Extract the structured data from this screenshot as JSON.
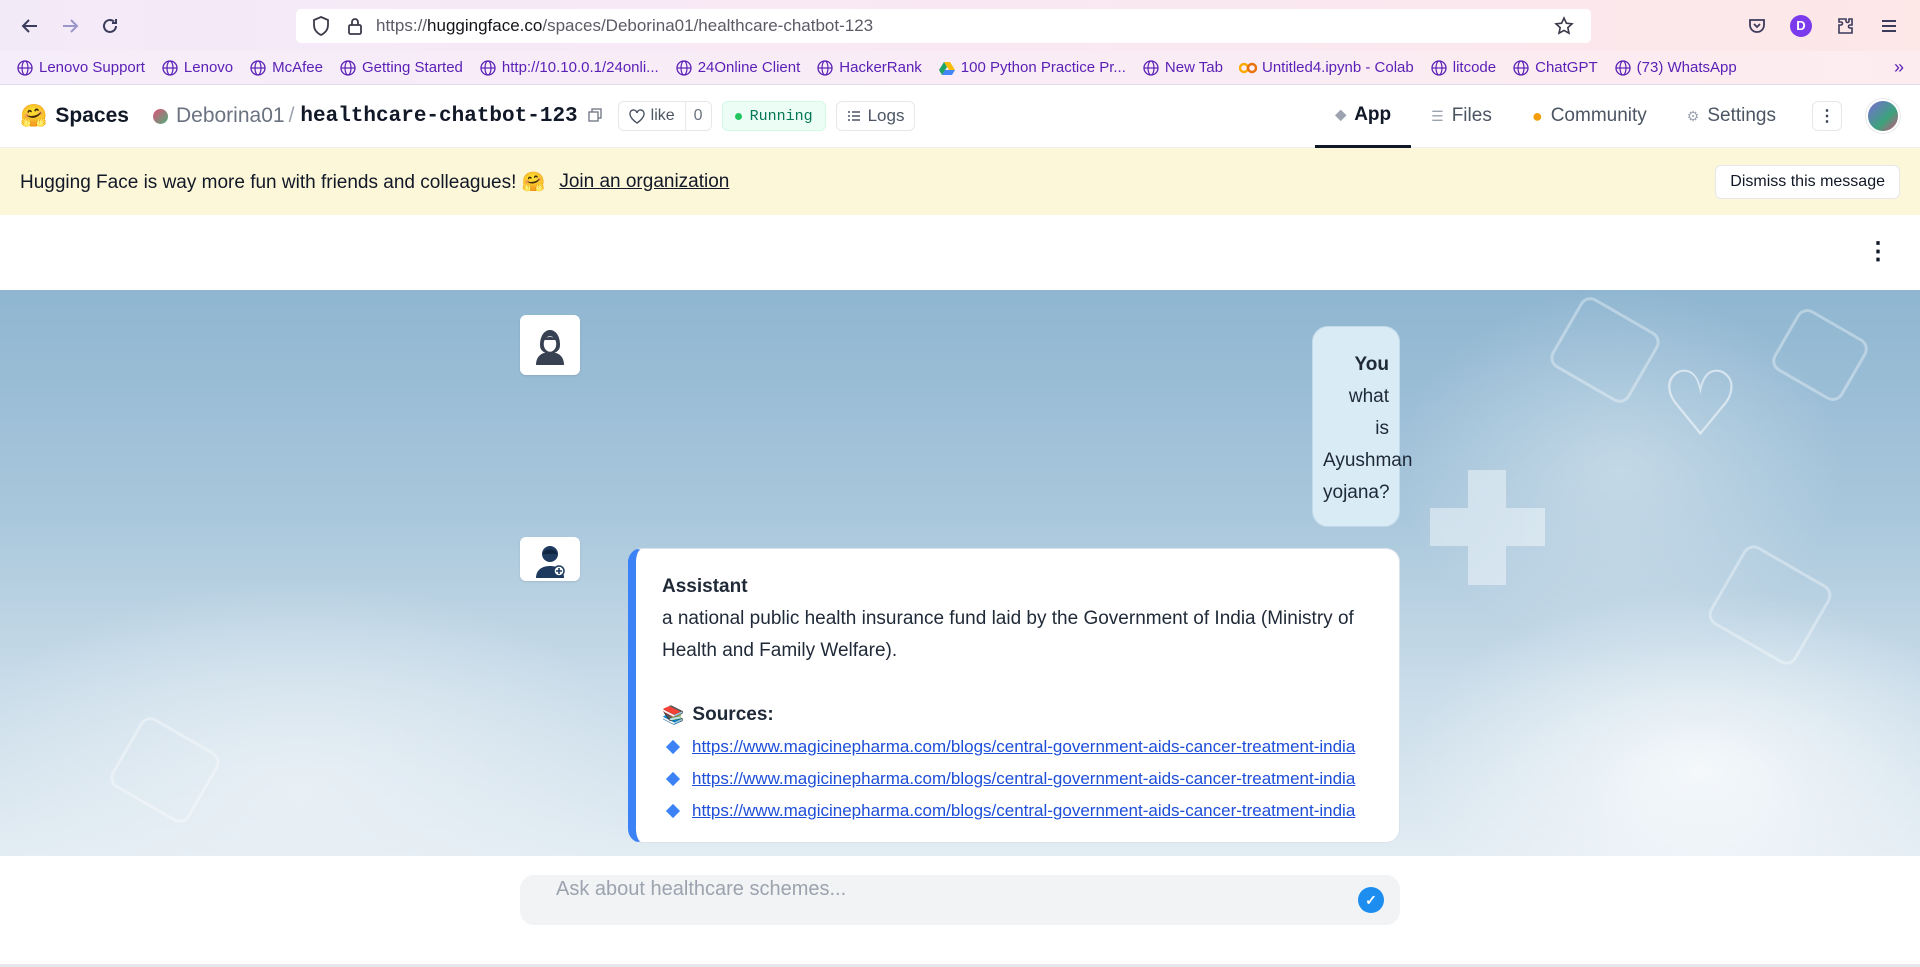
{
  "browser": {
    "url_prefix": "https://",
    "url_host": "huggingface.co",
    "url_path": "/spaces/Deborina01/healthcare-chatbot-123",
    "account_initial": "D"
  },
  "bookmarks": [
    {
      "label": "Lenovo Support",
      "icon": "globe-icon"
    },
    {
      "label": "Lenovo",
      "icon": "globe-icon"
    },
    {
      "label": "McAfee",
      "icon": "globe-icon"
    },
    {
      "label": "Getting Started",
      "icon": "globe-icon"
    },
    {
      "label": "http://10.10.0.1/24onli...",
      "icon": "globe-icon"
    },
    {
      "label": "24Online Client",
      "icon": "globe-icon"
    },
    {
      "label": "HackerRank",
      "icon": "globe-icon"
    },
    {
      "label": "100 Python Practice Pr...",
      "icon": "drive-icon"
    },
    {
      "label": "New Tab",
      "icon": "globe-icon"
    },
    {
      "label": "Untitled4.ipynb - Colab",
      "icon": "colab-icon"
    },
    {
      "label": "litcode",
      "icon": "globe-icon"
    },
    {
      "label": "ChatGPT",
      "icon": "globe-icon"
    },
    {
      "label": "(73) WhatsApp",
      "icon": "globe-icon"
    }
  ],
  "header": {
    "spaces_label": "Spaces",
    "owner": "Deborina01",
    "separator": "/",
    "repo": "healthcare-chatbot-123",
    "like_label": "like",
    "like_count": "0",
    "status": "Running",
    "logs_label": "Logs",
    "tabs": [
      {
        "label": "App",
        "active": true
      },
      {
        "label": "Files",
        "active": false
      },
      {
        "label": "Community",
        "active": false
      },
      {
        "label": "Settings",
        "active": false
      }
    ]
  },
  "banner": {
    "text": "Hugging Face is way more fun with friends and colleagues! 🤗",
    "link": "Join an organization",
    "dismiss": "Dismiss this message"
  },
  "chat": {
    "user": {
      "sender": "You",
      "message": "what is Ayushman yojana?"
    },
    "assistant": {
      "sender": "Assistant",
      "message": "a national public health insurance fund laid by the Government of India (Ministry of Health and Family Welfare).",
      "sources_label": "Sources:",
      "sources": [
        "https://www.magicinepharma.com/blogs/central-government-aids-cancer-treatment-india",
        "https://www.magicinepharma.com/blogs/central-government-aids-cancer-treatment-india",
        "https://www.magicinepharma.com/blogs/central-government-aids-cancer-treatment-india"
      ]
    }
  },
  "input": {
    "placeholder": "Ask about healthcare schemes..."
  },
  "colors": {
    "accent": "#3b82f6",
    "running": "#22c55e",
    "banner_bg": "#fdf7d9"
  }
}
